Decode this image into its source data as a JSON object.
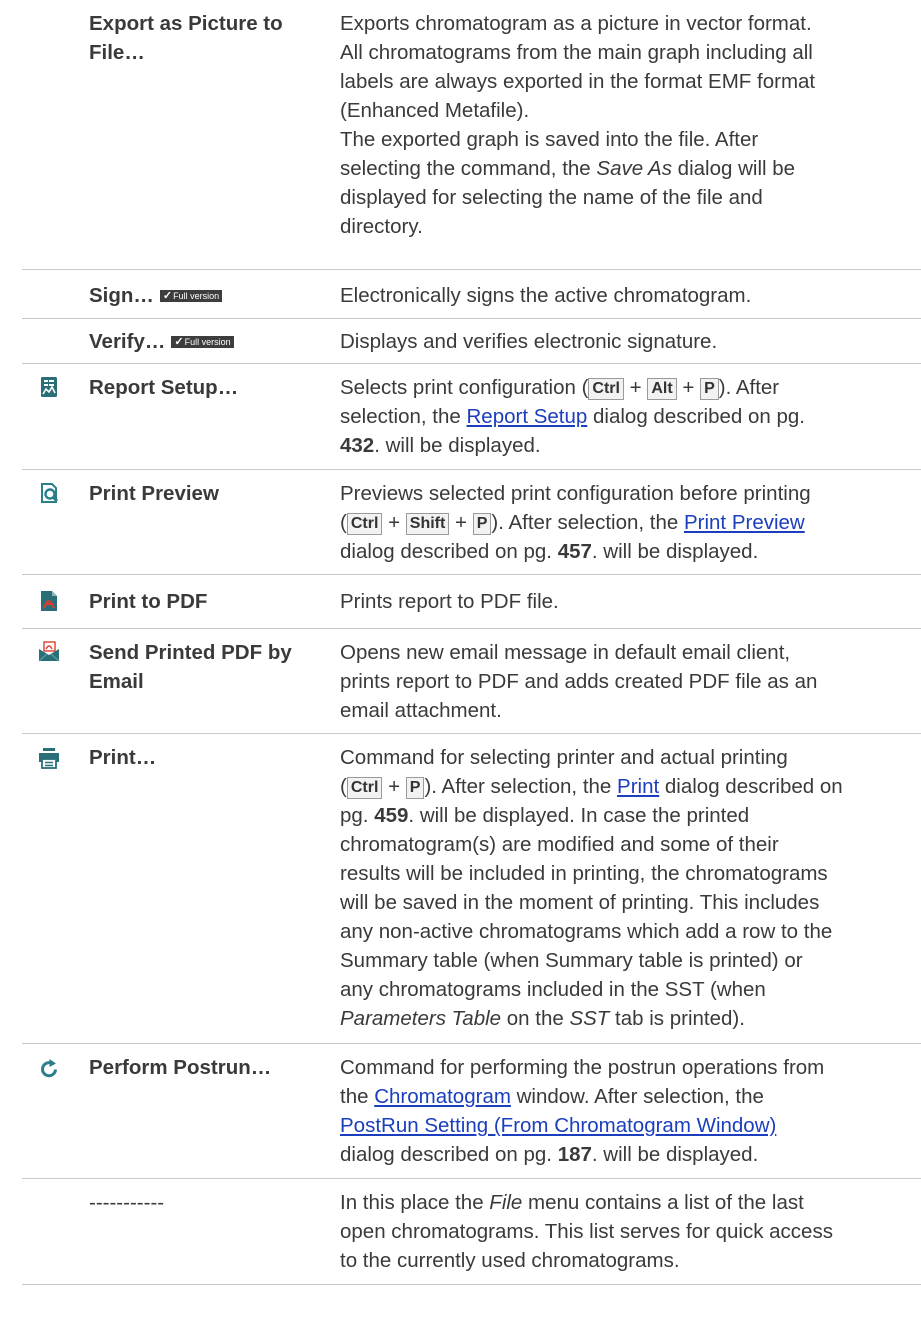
{
  "rows": {
    "export": {
      "command": "Export as Picture to File…",
      "cmd_l1": "Export as Picture to",
      "cmd_l2": "File…",
      "d1": "Exports chromatogram as a picture in vector format.",
      "d2": "All chromatograms from the main graph including all",
      "d3": "labels are always exported in the format EMF format",
      "d4": "(Enhanced Metafile).",
      "d5": "The exported graph is saved into the file. After",
      "d6a": "selecting the command, the ",
      "d6b": "Save As",
      "d6c": " dialog will be",
      "d7": "displayed for selecting the name of the file and",
      "d8": "directory."
    },
    "sign": {
      "command": "Sign…",
      "badge": "Full version",
      "desc": "Electronically signs the active chromatogram."
    },
    "verify": {
      "command": "Verify…",
      "badge": "Full version",
      "desc": "Displays and verifies electronic signature."
    },
    "report_setup": {
      "command": "Report Setup…",
      "icon": "report-setup-icon",
      "d1": "Selects print configuration (",
      "k1": "Ctrl",
      "plus": "+",
      "k2": "Alt",
      "k3": "P",
      "d1end": "). After",
      "d2a": "selection, the ",
      "link": "Report Setup",
      "d2b": " dialog described on pg.",
      "page": "432",
      "d3": ". will be displayed."
    },
    "print_preview": {
      "command": "Print Preview",
      "icon": "print-preview-icon",
      "d1": "Previews selected print configuration before printing",
      "open": "(",
      "k1": "Ctrl",
      "plus": "+",
      "k2": "Shift",
      "k3": "P",
      "d2a": "). After selection, the ",
      "link": "Print Preview",
      "d3a": "dialog described on pg. ",
      "page": "457",
      "d3b": ". will be displayed."
    },
    "print_pdf": {
      "command": "Print to PDF",
      "icon": "pdf-icon",
      "desc": "Prints report to PDF file."
    },
    "send_pdf": {
      "command": "Send Printed PDF by Email",
      "cmd_l1": "Send Printed PDF by",
      "cmd_l2": "Email",
      "icon": "email-pdf-icon",
      "d1": "Opens new email message in default email client,",
      "d2": "prints report to PDF and adds created PDF file as an",
      "d3": "email attachment."
    },
    "print": {
      "command": "Print…",
      "icon": "printer-icon",
      "d1": "Command for selecting printer and actual printing",
      "open": "(",
      "k1": "Ctrl",
      "plus": "+",
      "k2": "P",
      "d2a": "). After selection, the ",
      "link": "Print",
      "d2b": " dialog described on",
      "d3a": "pg. ",
      "page": "459",
      "d3b": ". will be displayed. In case the printed",
      "d4": "chromatogram(s) are modified and some of their",
      "d5": "results will be included in printing, the chromatograms",
      "d6": "will be saved in the moment of printing. This includes",
      "d7": "any non-active chromatograms which add a row to the",
      "d8": "Summary table (when Summary table is printed) or",
      "d9": "any chromatograms included in the SST (when",
      "d10a": "Parameters Table",
      "d10b": " on the ",
      "d10c": "SST",
      "d10d": " tab is printed)."
    },
    "postrun": {
      "command": "Perform Postrun…",
      "icon": "refresh-icon",
      "d1": "Command for performing the postrun operations from",
      "d2a": "the ",
      "link1": "Chromatogram",
      "d2b": " window. After selection, the",
      "link2": "PostRun Setting (From Chromatogram Window)",
      "d4a": "dialog described on pg. ",
      "page": "187",
      "d4b": ". will be displayed."
    },
    "recent": {
      "command": "-----------",
      "d1a": "In this place the ",
      "d1b": "File",
      "d1c": " menu contains a list of the last",
      "d2": "open chromatograms. This list serves for quick access",
      "d3": "to the currently used chromatograms."
    }
  }
}
